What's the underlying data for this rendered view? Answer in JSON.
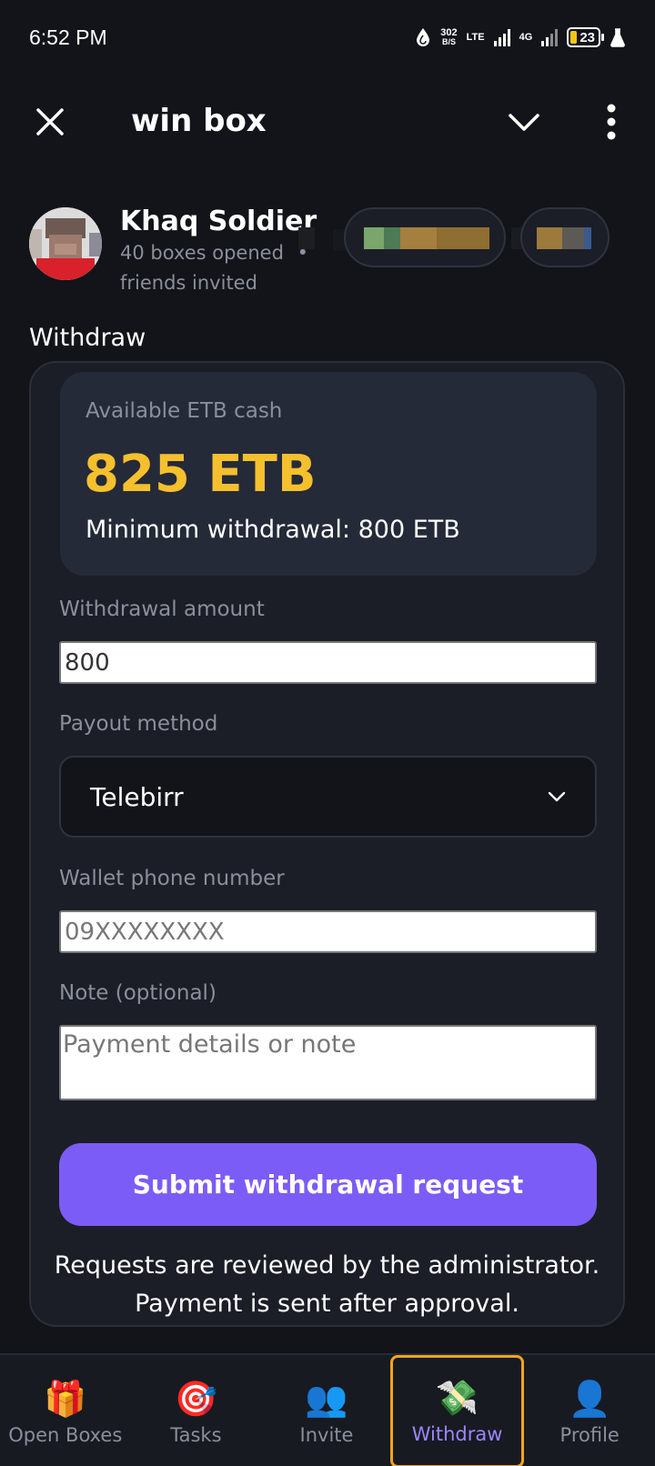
{
  "status_bar": {
    "time": "6:52 PM",
    "net_speed": "302",
    "net_unit": "B/S",
    "lte": "LTE",
    "net_4g": "4G",
    "battery": "23"
  },
  "header": {
    "title": "win box"
  },
  "profile": {
    "name": "Khaq Soldier",
    "boxes_opened": "40 boxes opened",
    "separator": "•",
    "friends_invited": "friends invited"
  },
  "withdraw": {
    "section_title": "Withdraw",
    "balance_label": "Available ETB cash",
    "balance_value": "825 ETB",
    "minimum_text": "Minimum withdrawal: 800 ETB",
    "amount_label": "Withdrawal amount",
    "amount_value": "800",
    "payout_label": "Payout method",
    "payout_value": "Telebirr",
    "phone_label": "Wallet phone number",
    "phone_placeholder": "09XXXXXXXX",
    "note_label": "Note (optional)",
    "note_placeholder": "Payment details or note",
    "submit_label": "Submit withdrawal request",
    "info_line1": "Requests are reviewed by the administrator.",
    "info_line2": "Payment is sent after approval."
  },
  "nav": {
    "items": [
      {
        "label": "Open Boxes",
        "icon": "🎁",
        "icon_name": "gift-icon"
      },
      {
        "label": "Tasks",
        "icon": "🎯",
        "icon_name": "target-icon"
      },
      {
        "label": "Invite",
        "icon": "👥",
        "icon_name": "people-icon"
      },
      {
        "label": "Withdraw",
        "icon": "💸",
        "icon_name": "money-wings-icon"
      },
      {
        "label": "Profile",
        "icon": "👤",
        "icon_name": "person-icon"
      }
    ],
    "active": "Withdraw"
  },
  "colors": {
    "accent": "#7c5cf6",
    "balance": "#f5c02e",
    "active_border": "#f2a51a"
  }
}
